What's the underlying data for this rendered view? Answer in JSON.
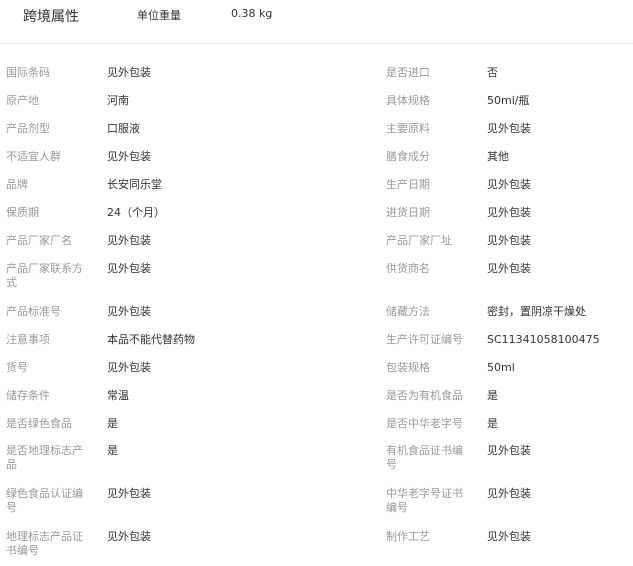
{
  "header": {
    "title": "跨境属性",
    "weight_label": "单位重量",
    "weight_value": "0.38 kg"
  },
  "rows": [
    {
      "left_label": "国际条码",
      "left_value": "见外包装",
      "right_label": "是否进口",
      "right_value": "否"
    },
    {
      "left_label": "原产地",
      "left_value": "河南",
      "right_label": "具体规格",
      "right_value": "50ml/瓶"
    },
    {
      "left_label": "产品剂型",
      "left_value": "口服液",
      "right_label": "主要原料",
      "right_value": "见外包装"
    },
    {
      "left_label": "不适宜人群",
      "left_value": "见外包装",
      "right_label": "膳食成分",
      "right_value": "其他"
    },
    {
      "left_label": "品牌",
      "left_value": "长安同乐堂",
      "right_label": "生产日期",
      "right_value": "见外包装"
    },
    {
      "left_label": "保质期",
      "left_value": "24（个月）",
      "right_label": "进货日期",
      "right_value": "见外包装"
    },
    {
      "left_label": "产品厂家厂名",
      "left_value": "见外包装",
      "right_label": "产品厂家厂址",
      "right_value": "见外包装"
    },
    {
      "left_label": "产品厂家联系方式",
      "left_value": "见外包装",
      "right_label": "供货商名",
      "right_value": "见外包装"
    },
    {
      "left_label": "产品标准号",
      "left_value": "见外包装",
      "right_label": "储藏方法",
      "right_value": "密封，置阴凉干燥处"
    },
    {
      "left_label": "注意事项",
      "left_value": "本品不能代替药物",
      "right_label": "生产许可证编号",
      "right_value": "SC11341058100475"
    },
    {
      "left_label": "货号",
      "left_value": "见外包装",
      "right_label": "包装规格",
      "right_value": "50ml"
    },
    {
      "left_label": "储存条件",
      "left_value": "常温",
      "right_label": "是否为有机食品",
      "right_value": "是"
    },
    {
      "left_label": "是否绿色食品",
      "left_value": "是",
      "right_label": "是否中华老字号",
      "right_value": "是"
    },
    {
      "left_label": "是否地理标志产品",
      "left_value": "是",
      "right_label": "有机食品证书编号",
      "right_value": "见外包装"
    },
    {
      "left_label": "绿色食品认证编号",
      "left_value": "见外包装",
      "right_label": "中华老字号证书编号",
      "right_value": "见外包装"
    },
    {
      "left_label": "地理标志产品证书编号",
      "left_value": "见外包装",
      "right_label": "制作工艺",
      "right_value": "见外包装"
    }
  ]
}
